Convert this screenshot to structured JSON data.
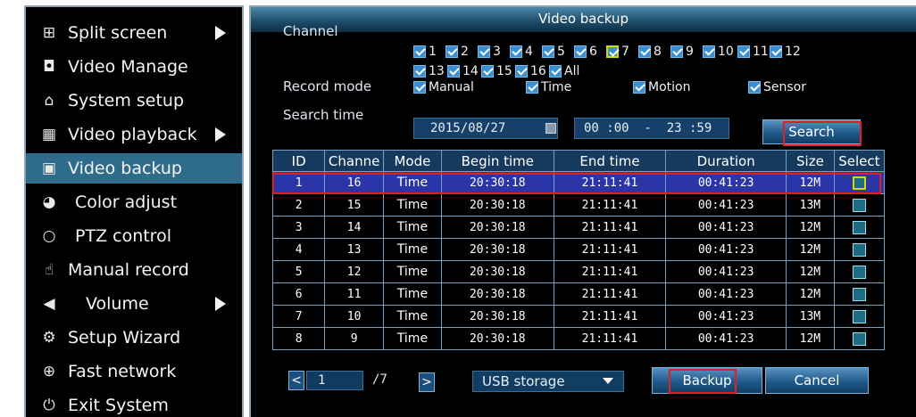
{
  "sidebar": {
    "items": [
      {
        "label": "Split screen",
        "icon": "grid-icon",
        "glyph": "⊞",
        "has_submenu": true
      },
      {
        "label": "Video Manage",
        "icon": "camera-icon",
        "glyph": "◘",
        "has_submenu": false
      },
      {
        "label": "System setup",
        "icon": "house-icon",
        "glyph": "⌂",
        "has_submenu": false
      },
      {
        "label": "Video playback",
        "icon": "film-icon",
        "glyph": "▦",
        "has_submenu": true
      },
      {
        "label": "Video backup",
        "icon": "floppy-icon",
        "glyph": "▣",
        "has_submenu": false,
        "active": true
      },
      {
        "label": "Color adjust",
        "icon": "palette-icon",
        "glyph": "◕",
        "has_submenu": false
      },
      {
        "label": "PTZ control",
        "icon": "ptz-icon",
        "glyph": "○",
        "has_submenu": false
      },
      {
        "label": "Manual record",
        "icon": "hand-icon",
        "glyph": "☝",
        "has_submenu": false
      },
      {
        "label": "Volume",
        "icon": "speaker-icon",
        "glyph": "◀",
        "has_submenu": true
      },
      {
        "label": "Setup Wizard",
        "icon": "wizard-icon",
        "glyph": "⚙",
        "has_submenu": false
      },
      {
        "label": "Fast network",
        "icon": "globe-icon",
        "glyph": "⊕",
        "has_submenu": false
      },
      {
        "label": "Exit System",
        "icon": "power-icon",
        "glyph": "⏻",
        "has_submenu": false
      }
    ]
  },
  "window": {
    "title": "Video backup"
  },
  "channel": {
    "label": "Channel",
    "row1": [
      "1",
      "2",
      "3",
      "4",
      "5",
      "6",
      "7",
      "8",
      "9",
      "10",
      "11",
      "12"
    ],
    "row2": [
      "13",
      "14",
      "15",
      "16",
      "All"
    ]
  },
  "record_mode": {
    "label": "Record mode",
    "options": [
      "Manual",
      "Time",
      "Motion",
      "Sensor"
    ]
  },
  "search_time": {
    "label": "Search time",
    "date": "2015/08/27",
    "time_range": "00 :00  -  23 :59",
    "search_button": "Search"
  },
  "table": {
    "headers": [
      "ID",
      "Channe",
      "Mode",
      "Begin time",
      "End time",
      "Duration",
      "Size",
      "Select"
    ],
    "rows": [
      [
        "1",
        "16",
        "Time",
        "20:30:18",
        "21:11:41",
        "00:41:23",
        "12M"
      ],
      [
        "2",
        "15",
        "Time",
        "20:30:18",
        "21:11:41",
        "00:41:23",
        "13M"
      ],
      [
        "3",
        "14",
        "Time",
        "20:30:18",
        "21:11:41",
        "00:41:23",
        "12M"
      ],
      [
        "4",
        "13",
        "Time",
        "20:30:18",
        "21:11:41",
        "00:41:23",
        "12M"
      ],
      [
        "5",
        "12",
        "Time",
        "20:30:18",
        "21:11:41",
        "00:41:23",
        "12M"
      ],
      [
        "6",
        "11",
        "Time",
        "20:30:18",
        "21:11:41",
        "00:41:23",
        "12M"
      ],
      [
        "7",
        "10",
        "Time",
        "20:30:18",
        "21:11:41",
        "00:41:23",
        "13M"
      ],
      [
        "8",
        "9",
        "Time",
        "20:30:18",
        "21:11:41",
        "00:41:23",
        "12M"
      ]
    ]
  },
  "footer": {
    "prev_glyph": "<",
    "next_glyph": ">",
    "page": "1",
    "total_pages": "/7",
    "storage": "USB storage",
    "backup_button": "Backup",
    "cancel_button": "Cancel"
  },
  "colors": {
    "highlight": "#e02020",
    "active_menu": "#2f6c8c",
    "selected_row": "#2c35a8"
  }
}
